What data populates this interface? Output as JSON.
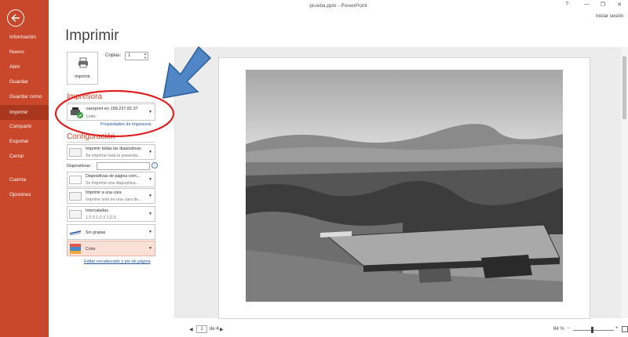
{
  "window": {
    "title": "prueba.pptx - PowerPoint",
    "help": "?",
    "minimize": "—",
    "restore": "❐",
    "close": "✕",
    "signin": "Iniciar sesión"
  },
  "nav": {
    "back_icon": "left-arrow-icon",
    "items": [
      {
        "label": "Información",
        "active": false
      },
      {
        "label": "Nuevo",
        "active": false
      },
      {
        "label": "Abrir",
        "active": false
      },
      {
        "label": "Guardar",
        "active": false
      },
      {
        "label": "Guardar como",
        "active": false
      },
      {
        "label": "Imprimir",
        "active": true
      },
      {
        "label": "Compartir",
        "active": false
      },
      {
        "label": "Exportar",
        "active": false
      },
      {
        "label": "Cerrar",
        "active": false
      },
      {
        "label": "Cuenta",
        "active": false
      },
      {
        "label": "Opciones",
        "active": false
      }
    ]
  },
  "print": {
    "heading": "Imprimir",
    "button_label": "Imprimir",
    "copies_label": "Copias:",
    "copies_value": "1"
  },
  "printer": {
    "section_title": "Impresora",
    "name": "sareprint en 158.227.82.37",
    "status": "Listo",
    "properties_link": "Propiedades de impresora"
  },
  "settings": {
    "section_title": "Configuración",
    "slides_label": "Diapositivas:",
    "slides_value": "",
    "info_icon": "i",
    "range": {
      "title": "Imprimir todas las diapositivas",
      "desc": "Se imprime toda la presenta..."
    },
    "layout": {
      "title": "Diapositivas de página com...",
      "desc": "Se imprime una diapositiva..."
    },
    "sides": {
      "title": "Imprimir a una cara",
      "desc": "Imprime solo en una cara de..."
    },
    "collate": {
      "title": "Intercaladas",
      "desc": "1;2;3    1;2;3    1;2;3"
    },
    "staple": {
      "title": "Sin grapas"
    },
    "color": {
      "title": "Color"
    },
    "header_footer_link": "Editar encabezado y pie de página"
  },
  "preview": {
    "page_current": "1",
    "page_of": "de 4",
    "zoom": "84 %",
    "zoom_minus": "−",
    "zoom_plus": "+"
  },
  "colors": {
    "nav_bg": "#c9472b",
    "nav_active": "#a8371e",
    "accent": "#c9472b",
    "link": "#2b579a",
    "annotation_circle": "#e02020",
    "annotation_arrow": "#4f86c6"
  }
}
